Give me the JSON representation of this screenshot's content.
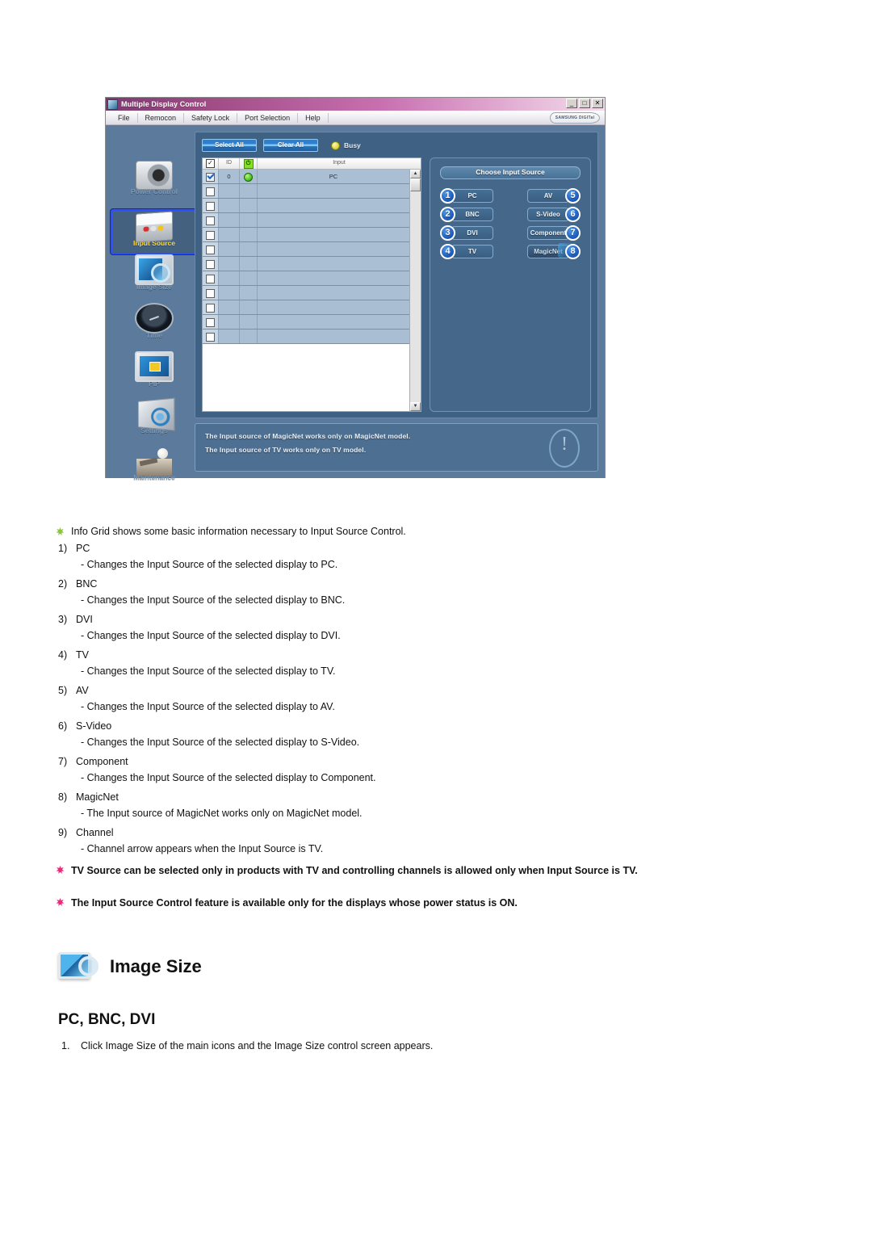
{
  "app": {
    "title": "Multiple Display Control",
    "window_buttons": [
      "_",
      "□",
      "✕"
    ],
    "brand": "SAMSUNG DIGITal",
    "menu": [
      "File",
      "Remocon",
      "Safety Lock",
      "Port Selection",
      "Help"
    ],
    "sidebar": [
      {
        "label": "Power Control",
        "icon": "power-control-icon",
        "active": false
      },
      {
        "label": "Input Source",
        "icon": "input-source-icon",
        "active": true
      },
      {
        "label": "Image Size",
        "icon": "image-size-icon",
        "active": false
      },
      {
        "label": "Time",
        "icon": "time-icon",
        "active": false
      },
      {
        "label": "PIP",
        "icon": "pip-icon",
        "active": false
      },
      {
        "label": "Settings",
        "icon": "settings-icon",
        "active": false
      },
      {
        "label": "Maintenance",
        "icon": "maintenance-icon",
        "active": false
      }
    ],
    "toolbar": {
      "select_all": "Select All",
      "clear_all": "Clear All",
      "busy_label": "Busy",
      "busy_color": "#d9d233"
    },
    "grid": {
      "headers": [
        "",
        "ID",
        "",
        "Input"
      ],
      "header_check_glyph": "✓",
      "header_power_glyph": "⏻",
      "rows": [
        {
          "checked": true,
          "id": "0",
          "power": "on",
          "input": "PC"
        },
        {
          "checked": false,
          "id": "",
          "power": "",
          "input": ""
        },
        {
          "checked": false,
          "id": "",
          "power": "",
          "input": ""
        },
        {
          "checked": false,
          "id": "",
          "power": "",
          "input": ""
        },
        {
          "checked": false,
          "id": "",
          "power": "",
          "input": ""
        },
        {
          "checked": false,
          "id": "",
          "power": "",
          "input": ""
        },
        {
          "checked": false,
          "id": "",
          "power": "",
          "input": ""
        },
        {
          "checked": false,
          "id": "",
          "power": "",
          "input": ""
        },
        {
          "checked": false,
          "id": "",
          "power": "",
          "input": ""
        },
        {
          "checked": false,
          "id": "",
          "power": "",
          "input": ""
        },
        {
          "checked": false,
          "id": "",
          "power": "",
          "input": ""
        },
        {
          "checked": false,
          "id": "",
          "power": "",
          "input": ""
        }
      ],
      "scroll_up_glyph": "▲",
      "scroll_down_glyph": "▼"
    },
    "chooser": {
      "title": "Choose Input Source",
      "buttons": [
        {
          "badge": "1",
          "label": "PC",
          "side": "left"
        },
        {
          "badge": "5",
          "label": "AV",
          "side": "right"
        },
        {
          "badge": "2",
          "label": "BNC",
          "side": "left"
        },
        {
          "badge": "6",
          "label": "S-Video",
          "side": "right"
        },
        {
          "badge": "3",
          "label": "DVI",
          "side": "left"
        },
        {
          "badge": "7",
          "label": "Component",
          "side": "right"
        },
        {
          "badge": "4",
          "label": "TV",
          "side": "left"
        },
        {
          "badge": "8",
          "label": "MagicNet",
          "side": "right"
        }
      ]
    },
    "info": {
      "line1": "The Input source of MagicNet works only on MagicNet model.",
      "line2": "The Input source of TV works only on TV  model."
    }
  },
  "doc": {
    "intro": "Info Grid shows some basic information necessary to Input Source Control.",
    "items": [
      {
        "n": "1)",
        "label": "PC",
        "desc": "- Changes the Input Source of the selected display to PC."
      },
      {
        "n": "2)",
        "label": "BNC",
        "desc": "- Changes the Input Source of the selected display to BNC."
      },
      {
        "n": "3)",
        "label": "DVI",
        "desc": "- Changes the Input Source of the selected display to DVI."
      },
      {
        "n": "4)",
        "label": "TV",
        "desc": "- Changes the Input Source of the selected display to TV."
      },
      {
        "n": "5)",
        "label": "AV",
        "desc": "- Changes the Input Source of the selected display to AV."
      },
      {
        "n": "6)",
        "label": "S-Video",
        "desc": "- Changes the Input Source of the selected display to S-Video."
      },
      {
        "n": "7)",
        "label": "Component",
        "desc": "- Changes the Input Source of the selected display to Component."
      },
      {
        "n": "8)",
        "label": "MagicNet",
        "desc": "- The Input source of MagicNet works only on MagicNet model."
      },
      {
        "n": "9)",
        "label": "Channel",
        "desc": "- Channel arrow appears when the Input Source is TV."
      }
    ],
    "notes": [
      "TV Source can be selected only in products with TV and controlling channels is allowed only when Input Source is TV.",
      "The Input Source Control feature is available only for the displays whose power status is ON."
    ],
    "section_title": "Image Size",
    "subsection_title": "PC, BNC, DVI",
    "step_number": "1.",
    "step_text": "Click Image Size of the main icons and the Image Size control screen appears."
  },
  "colors": {
    "star_green": "#8cc63f",
    "star_pink": "#ec297b",
    "accent_blue": "#1f5fc0",
    "app_bg": "#5b7a9c"
  }
}
